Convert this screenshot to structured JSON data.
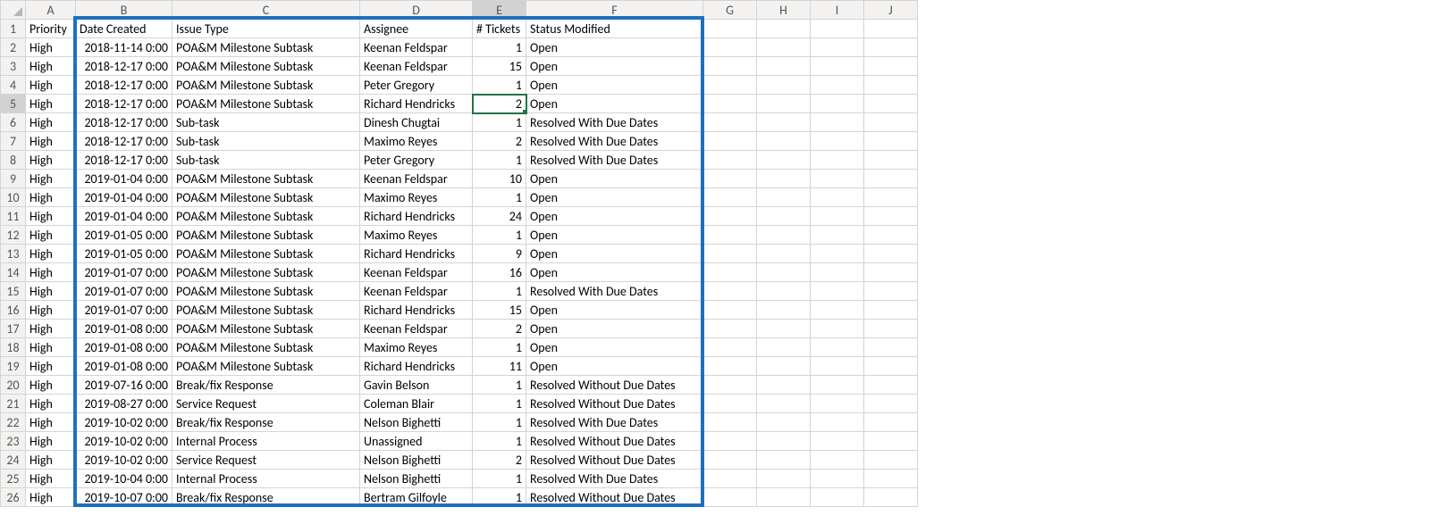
{
  "columns": [
    "A",
    "B",
    "C",
    "D",
    "E",
    "F",
    "G",
    "H",
    "I",
    "J"
  ],
  "headers": {
    "A": "Priority",
    "B": "Date Created",
    "C": "Issue Type",
    "D": "Assignee",
    "E": "# Tickets",
    "F": "Status Modified"
  },
  "active_cell": "E5",
  "selected_col": "E",
  "selected_row": 5,
  "rows": [
    {
      "priority": "High",
      "date": "2018-11-14 0:00",
      "type": "POA&M Milestone Subtask",
      "assignee": "Keenan Feldspar",
      "tickets": 1,
      "status": "Open"
    },
    {
      "priority": "High",
      "date": "2018-12-17 0:00",
      "type": "POA&M Milestone Subtask",
      "assignee": "Keenan Feldspar",
      "tickets": 15,
      "status": "Open"
    },
    {
      "priority": "High",
      "date": "2018-12-17 0:00",
      "type": "POA&M Milestone Subtask",
      "assignee": "Peter Gregory",
      "tickets": 1,
      "status": "Open"
    },
    {
      "priority": "High",
      "date": "2018-12-17 0:00",
      "type": "POA&M Milestone Subtask",
      "assignee": "Richard Hendricks",
      "tickets": 2,
      "status": "Open"
    },
    {
      "priority": "High",
      "date": "2018-12-17 0:00",
      "type": "Sub-task",
      "assignee": "Dinesh Chugtai",
      "tickets": 1,
      "status": "Resolved With Due Dates"
    },
    {
      "priority": "High",
      "date": "2018-12-17 0:00",
      "type": "Sub-task",
      "assignee": "Maximo Reyes",
      "tickets": 2,
      "status": "Resolved With Due Dates"
    },
    {
      "priority": "High",
      "date": "2018-12-17 0:00",
      "type": "Sub-task",
      "assignee": "Peter Gregory",
      "tickets": 1,
      "status": "Resolved With Due Dates"
    },
    {
      "priority": "High",
      "date": "2019-01-04 0:00",
      "type": "POA&M Milestone Subtask",
      "assignee": "Keenan Feldspar",
      "tickets": 10,
      "status": "Open"
    },
    {
      "priority": "High",
      "date": "2019-01-04 0:00",
      "type": "POA&M Milestone Subtask",
      "assignee": "Maximo Reyes",
      "tickets": 1,
      "status": "Open"
    },
    {
      "priority": "High",
      "date": "2019-01-04 0:00",
      "type": "POA&M Milestone Subtask",
      "assignee": "Richard Hendricks",
      "tickets": 24,
      "status": "Open"
    },
    {
      "priority": "High",
      "date": "2019-01-05 0:00",
      "type": "POA&M Milestone Subtask",
      "assignee": "Maximo Reyes",
      "tickets": 1,
      "status": "Open"
    },
    {
      "priority": "High",
      "date": "2019-01-05 0:00",
      "type": "POA&M Milestone Subtask",
      "assignee": "Richard Hendricks",
      "tickets": 9,
      "status": "Open"
    },
    {
      "priority": "High",
      "date": "2019-01-07 0:00",
      "type": "POA&M Milestone Subtask",
      "assignee": "Keenan Feldspar",
      "tickets": 16,
      "status": "Open"
    },
    {
      "priority": "High",
      "date": "2019-01-07 0:00",
      "type": "POA&M Milestone Subtask",
      "assignee": "Keenan Feldspar",
      "tickets": 1,
      "status": "Resolved With Due Dates"
    },
    {
      "priority": "High",
      "date": "2019-01-07 0:00",
      "type": "POA&M Milestone Subtask",
      "assignee": "Richard Hendricks",
      "tickets": 15,
      "status": "Open"
    },
    {
      "priority": "High",
      "date": "2019-01-08 0:00",
      "type": "POA&M Milestone Subtask",
      "assignee": "Keenan Feldspar",
      "tickets": 2,
      "status": "Open"
    },
    {
      "priority": "High",
      "date": "2019-01-08 0:00",
      "type": "POA&M Milestone Subtask",
      "assignee": "Maximo Reyes",
      "tickets": 1,
      "status": "Open"
    },
    {
      "priority": "High",
      "date": "2019-01-08 0:00",
      "type": "POA&M Milestone Subtask",
      "assignee": "Richard Hendricks",
      "tickets": 11,
      "status": "Open"
    },
    {
      "priority": "High",
      "date": "2019-07-16 0:00",
      "type": "Break/fix Response",
      "assignee": "Gavin Belson",
      "tickets": 1,
      "status": "Resolved Without Due Dates"
    },
    {
      "priority": "High",
      "date": "2019-08-27 0:00",
      "type": "Service Request",
      "assignee": "Coleman Blair",
      "tickets": 1,
      "status": "Resolved Without Due Dates"
    },
    {
      "priority": "High",
      "date": "2019-10-02 0:00",
      "type": "Break/fix Response",
      "assignee": "Nelson Bighetti",
      "tickets": 1,
      "status": "Resolved With Due Dates"
    },
    {
      "priority": "High",
      "date": "2019-10-02 0:00",
      "type": "Internal Process",
      "assignee": "Unassigned",
      "tickets": 1,
      "status": "Resolved Without Due Dates"
    },
    {
      "priority": "High",
      "date": "2019-10-02 0:00",
      "type": "Service Request",
      "assignee": "Nelson Bighetti",
      "tickets": 2,
      "status": "Resolved Without Due Dates"
    },
    {
      "priority": "High",
      "date": "2019-10-04 0:00",
      "type": "Internal Process",
      "assignee": "Nelson Bighetti",
      "tickets": 1,
      "status": "Resolved With Due Dates"
    },
    {
      "priority": "High",
      "date": "2019-10-07 0:00",
      "type": "Break/fix Response",
      "assignee": "Bertram Gilfoyle",
      "tickets": 1,
      "status": "Resolved Without Due Dates"
    }
  ],
  "highlight_box": {
    "col_start": "B",
    "col_end": "F",
    "row_start": 1,
    "row_end": 26
  }
}
